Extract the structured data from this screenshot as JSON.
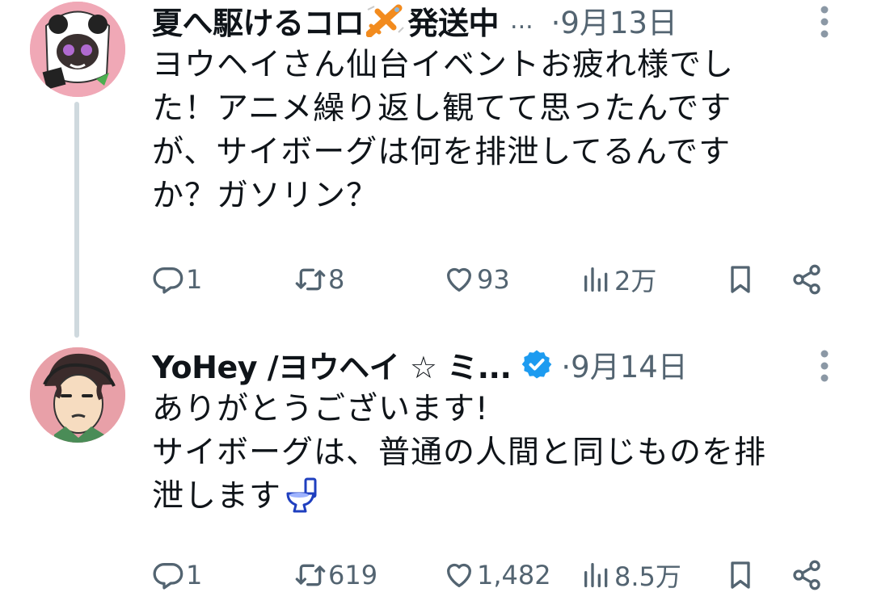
{
  "tweets": [
    {
      "author": {
        "display_name": "夏へ駆けるコロ",
        "name_suffix": "発送中",
        "truncation": "...",
        "avatar_color": "#f0a8b6"
      },
      "date": "·9月13日",
      "text_lines": [
        "ヨウヘイさん仙台イベントお疲れ様でし",
        "た！アニメ繰り返し観てて思ったんです",
        "が、サイボーグは何を排泄してるんです",
        "か？ガソリン？"
      ],
      "stats": {
        "replies": "1",
        "retweets": "8",
        "likes": "93",
        "views": "2万"
      }
    },
    {
      "author": {
        "display_name": "YoHey /ヨウヘイ ☆ ミ...",
        "verified": true,
        "avatar_color": "#e8a0a8"
      },
      "date": "·9月14日",
      "text_lines": [
        "ありがとうございます!",
        "サイボーグは、普通の人間と同じものを排",
        "泄します"
      ],
      "stats": {
        "replies": "1",
        "retweets": "619",
        "likes": "1,482",
        "views": "8.5万"
      }
    }
  ],
  "icons": {
    "reply": "speech-bubble-icon",
    "retweet": "retweet-arrows-icon",
    "like": "heart-outline-icon",
    "views": "bar-chart-icon",
    "bookmark": "bookmark-icon",
    "share": "share-nodes-icon",
    "more": "vertical-dots-icon",
    "toilet": "toilet-icon",
    "airplane": "airplane-emoji-icon",
    "verified": "verified-badge-icon"
  },
  "colors": {
    "text": "#0f1419",
    "secondary": "#536471",
    "verified_blue": "#1d9bf0",
    "thread_line": "#cfd9de"
  }
}
